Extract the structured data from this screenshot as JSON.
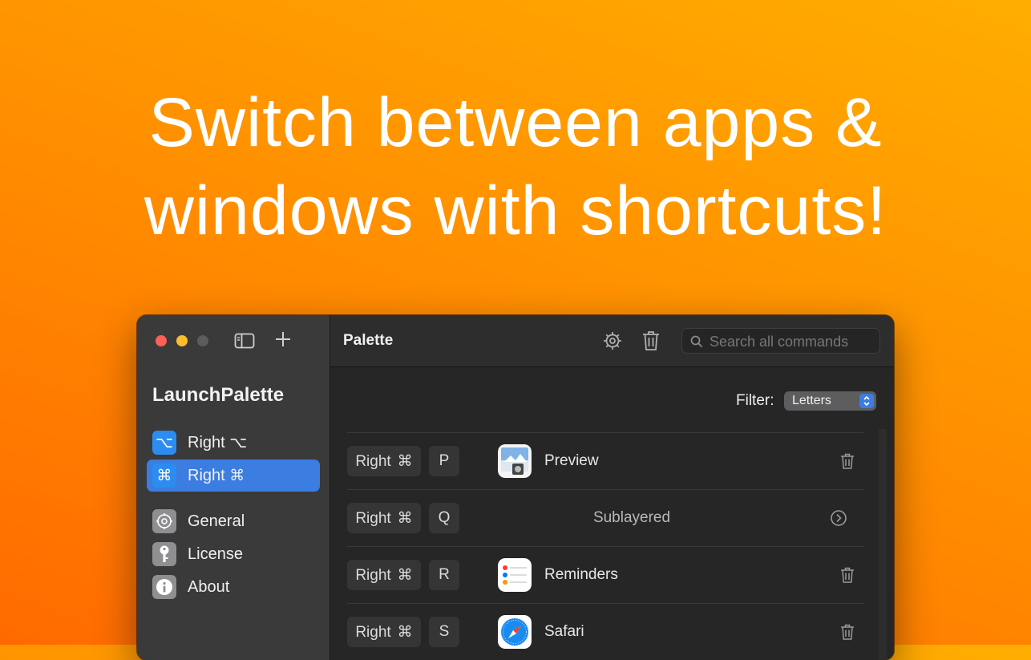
{
  "headline": {
    "line1": "Switch between apps &",
    "line2": "windows with shortcuts!"
  },
  "sidebar": {
    "app_title": "LaunchPalette",
    "items": [
      {
        "label": "Right",
        "symbol": "⌥",
        "icon": "option-key-icon",
        "active": false
      },
      {
        "label": "Right",
        "symbol": "⌘",
        "icon": "command-key-icon",
        "active": true
      },
      {
        "label": "General",
        "icon": "gear-icon",
        "active": false
      },
      {
        "label": "License",
        "icon": "key-icon",
        "active": false
      },
      {
        "label": "About",
        "icon": "info-icon",
        "active": false
      }
    ],
    "toolbar_icons": [
      "sidebar-toggle-icon",
      "plus-icon"
    ]
  },
  "toolbar": {
    "title": "Palette",
    "search_placeholder": "Search all commands",
    "icons": [
      "gear-icon",
      "trash-icon",
      "search-icon"
    ]
  },
  "filter": {
    "label": "Filter:",
    "selected": "Letters"
  },
  "shortcuts": [
    {
      "modifier": "Right",
      "mod_symbol": "⌘",
      "key": "P",
      "app": "Preview",
      "icon": "preview-app-icon",
      "action": "trash-icon"
    },
    {
      "modifier": "Right",
      "mod_symbol": "⌘",
      "key": "Q",
      "app": "Sublayered",
      "icon": "",
      "action": "chevron-right-circle-icon"
    },
    {
      "modifier": "Right",
      "mod_symbol": "⌘",
      "key": "R",
      "app": "Reminders",
      "icon": "reminders-app-icon",
      "action": "trash-icon"
    },
    {
      "modifier": "Right",
      "mod_symbol": "⌘",
      "key": "S",
      "app": "Safari",
      "icon": "safari-app-icon",
      "action": "trash-icon"
    }
  ],
  "colors": {
    "accent": "#3b7de0",
    "background_gradient": [
      "#ffad00",
      "#ff6a00"
    ]
  }
}
